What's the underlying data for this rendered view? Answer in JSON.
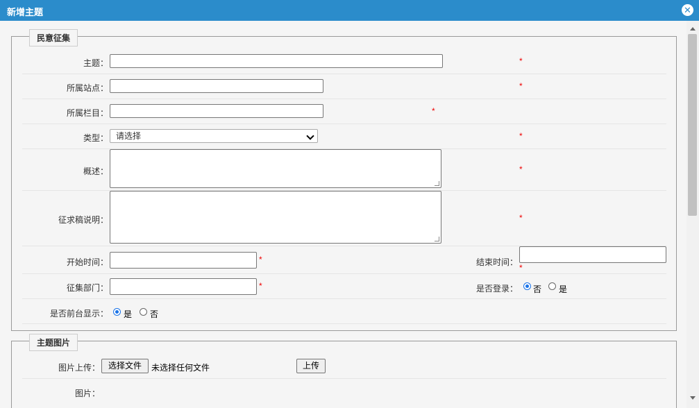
{
  "dialog": {
    "title": "新增主题",
    "close_icon": "close-icon"
  },
  "section1": {
    "legend": "民意征集",
    "subject_label": "主题：",
    "site_label": "所属站点：",
    "column_label": "所属栏目：",
    "type_label": "类型：",
    "type_selected": "请选择",
    "summary_label": "概述：",
    "draft_label": "征求稿说明：",
    "start_label": "开始时间：",
    "end_label": "结束时间：",
    "dept_label": "征集部门：",
    "login_label": "是否登录：",
    "login_no": "否",
    "login_yes": "是",
    "frontend_label": "是否前台显示：",
    "frontend_yes": "是",
    "frontend_no": "否",
    "required_mark": "*"
  },
  "section2": {
    "legend": "主题图片",
    "upload_label": "图片上传：",
    "choose_file_button": "选择文件",
    "no_file_text": "未选择任何文件",
    "upload_button": "上传",
    "image_label": "图片："
  },
  "colors": {
    "titlebar": "#2b8ccb",
    "required": "#ee0000",
    "radio_checked": "#1a73e8"
  }
}
